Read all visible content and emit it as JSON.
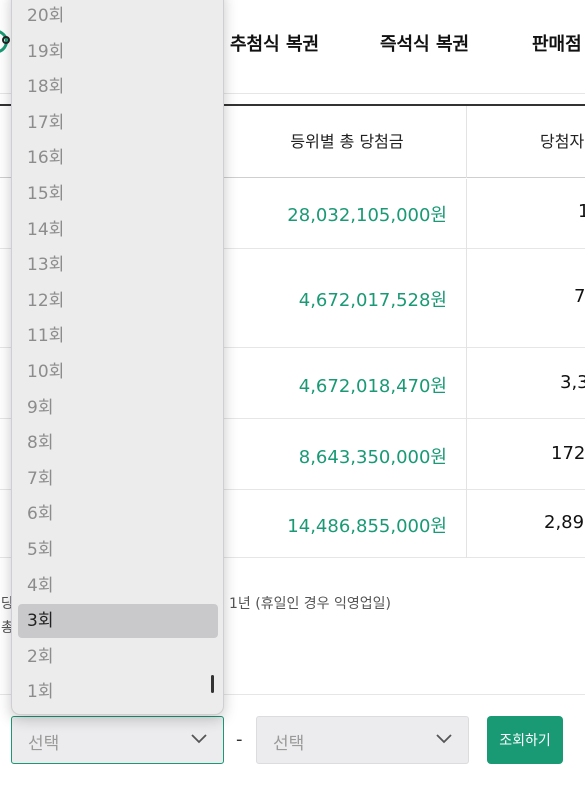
{
  "nav": {
    "items": [
      "추첨식 복권",
      "즉석식 복권",
      "판매점"
    ]
  },
  "table": {
    "headers": {
      "amount": "등위별 총 당첨금",
      "winners": "당첨자"
    },
    "rows": [
      {
        "amount": "28,032,105,000원",
        "winners": "1"
      },
      {
        "amount": "4,672,017,528원",
        "winners": "7"
      },
      {
        "amount": "4,672,018,470원",
        "winners": "3,3"
      },
      {
        "amount": "8,643,350,000원",
        "winners": "172,"
      },
      {
        "amount": "14,486,855,000원",
        "winners": "2,89"
      }
    ]
  },
  "notes": {
    "line1_prefix": "당",
    "line1_text": "1년 (휴일인 경우 익영업일)",
    "line2_prefix": "총"
  },
  "search": {
    "select1": "선택",
    "select2": "선택",
    "separator": "-",
    "button": "조회하기"
  },
  "dropdown": {
    "options": [
      "20회",
      "19회",
      "18회",
      "17회",
      "16회",
      "15회",
      "14회",
      "13회",
      "12회",
      "11회",
      "10회",
      "9회",
      "8회",
      "7회",
      "6회",
      "5회",
      "4회",
      "3회",
      "2회",
      "1회"
    ],
    "selected_index": 17
  },
  "colors": {
    "accent": "#1a9a74"
  }
}
